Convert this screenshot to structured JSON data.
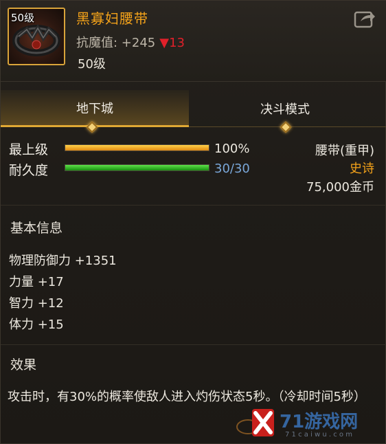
{
  "item": {
    "level_badge": "50级",
    "name": "黑寡妇腰带",
    "resist_label": "抗魔值: +245",
    "resist_change": "13",
    "level_text": "50级"
  },
  "tabs": [
    {
      "label": "地下城",
      "active": true
    },
    {
      "label": "决斗模式",
      "active": false
    }
  ],
  "bars": {
    "level": {
      "label": "最上级",
      "value_text": "100%",
      "fraction": 1.0
    },
    "durability": {
      "label": "耐久度",
      "value_text": "30/30",
      "fraction": 1.0
    }
  },
  "info": {
    "type": "腰带(重甲)",
    "rarity": "史诗",
    "price": "75,000金币"
  },
  "basic": {
    "title": "基本信息",
    "stats": [
      "物理防御力 +1351",
      "力量 +17",
      "智力 +12",
      "体力 +15"
    ]
  },
  "effect": {
    "title": "效果",
    "text": "攻击时，有30%的概率使敌人进入灼伤状态5秒。（冷却时间5秒）"
  },
  "watermark": {
    "text": "71游戏网",
    "sub": "7 1 c a i w u . c o m"
  },
  "colors": {
    "item_name": "#f3a21a",
    "rarity": "#f3a21a",
    "resist_down": "#e0202a",
    "durability_text": "#7aa7d9",
    "tab_active": "#e0a834"
  }
}
